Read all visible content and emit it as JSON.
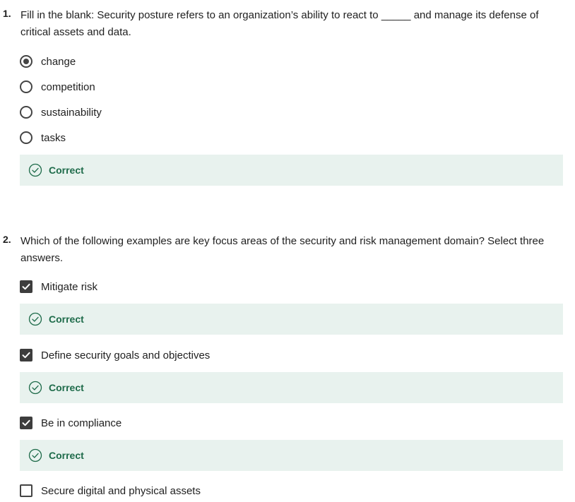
{
  "questions": [
    {
      "number": "1.",
      "text": "Fill in the blank: Security posture refers to an organization’s ability to react to _____ and manage its defense of critical assets and data.",
      "type": "radio",
      "options": [
        {
          "label": "change",
          "checked": true
        },
        {
          "label": "competition",
          "checked": false
        },
        {
          "label": "sustainability",
          "checked": false
        },
        {
          "label": "tasks",
          "checked": false
        }
      ],
      "feedback": "Correct"
    },
    {
      "number": "2.",
      "text": "Which of the following examples are key focus areas of the security and risk management domain? Select three answers.",
      "type": "checkbox",
      "options": [
        {
          "label": "Mitigate risk",
          "checked": true,
          "feedback": "Correct"
        },
        {
          "label": "Define security goals and objectives",
          "checked": true,
          "feedback": "Correct"
        },
        {
          "label": "Be in compliance",
          "checked": true,
          "feedback": "Correct"
        },
        {
          "label": "Secure digital and physical assets",
          "checked": false
        }
      ]
    }
  ],
  "colors": {
    "feedback_bg": "#e8f2ee",
    "feedback_text": "#1e6b4a",
    "control": "#444444"
  },
  "icons": {
    "feedback": "check-circle-icon",
    "checkmark": "checkmark-icon"
  }
}
